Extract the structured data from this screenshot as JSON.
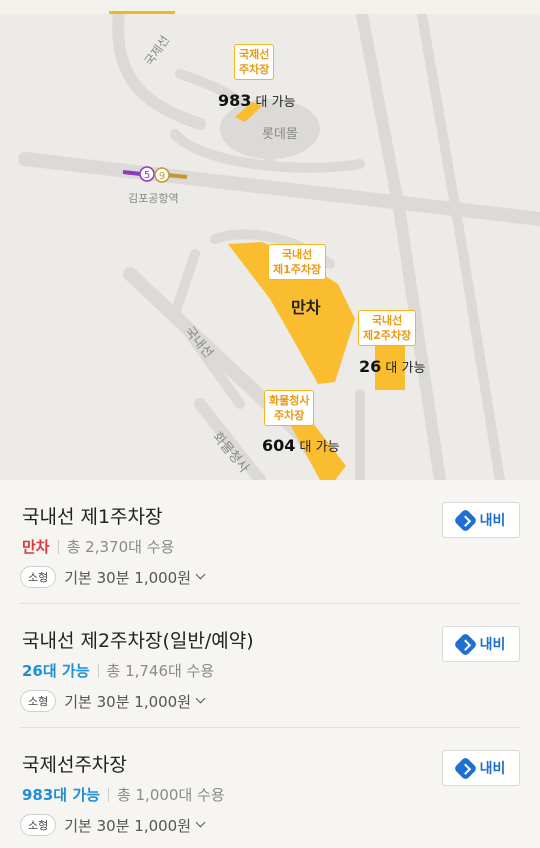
{
  "map": {
    "labels": {
      "intl_road": "국제선",
      "domestic_road": "국내선",
      "cargo_road": "화물청사",
      "lotte_mall": "롯데몰",
      "station": "김포공항역",
      "line5": "5",
      "line9": "9"
    },
    "lots": {
      "intl": {
        "label": "국제선\n주차장",
        "count": "983",
        "suffix": "대 가능"
      },
      "dom1": {
        "label": "국내선\n제1주차장",
        "status": "만차"
      },
      "dom2": {
        "label": "국내선\n제2주차장",
        "count": "26",
        "suffix": "대 가능"
      },
      "cargo": {
        "label": "화물청사\n주차장",
        "count": "604",
        "suffix": "대 가능"
      }
    },
    "colors": {
      "lot": "#f9bd2f",
      "road": "#dcdad6",
      "line5": "#8b3bbd",
      "line9": "#c29a31"
    }
  },
  "items": [
    {
      "title": "국내선 제1주차장",
      "status": "만차",
      "status_type": "full",
      "capacity": "총 2,370대 수용",
      "badge": "소형",
      "fee": "기본 30분 1,000원",
      "nav_label": "내비"
    },
    {
      "title": "국내선 제2주차장(일반/예약)",
      "status": "26대 가능",
      "status_type": "ok",
      "capacity": "총 1,746대 수용",
      "badge": "소형",
      "fee": "기본 30분 1,000원",
      "nav_label": "내비"
    },
    {
      "title": "국제선주차장",
      "status": "983대 가능",
      "status_type": "ok",
      "capacity": "총 1,000대 수용",
      "badge": "소형",
      "fee": "기본 30분 1,000원",
      "nav_label": "내비"
    }
  ]
}
